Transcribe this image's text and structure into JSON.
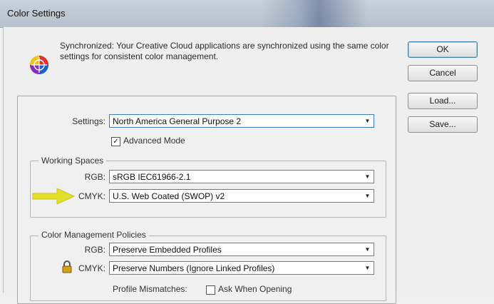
{
  "window": {
    "title": "Color Settings"
  },
  "sync": {
    "message": "Synchronized: Your Creative Cloud applications are synchronized using the same color settings for consistent color management."
  },
  "buttons": {
    "ok": "OK",
    "cancel": "Cancel",
    "load": "Load...",
    "save": "Save..."
  },
  "settings": {
    "label": "Settings:",
    "value": "North America General Purpose 2",
    "advanced_mode_label": "Advanced Mode",
    "advanced_mode_checked": true
  },
  "working_spaces": {
    "legend": "Working Spaces",
    "rgb_label": "RGB:",
    "rgb_value": "sRGB IEC61966-2.1",
    "cmyk_label": "CMYK:",
    "cmyk_value": "U.S. Web Coated (SWOP) v2"
  },
  "policies": {
    "legend": "Color Management Policies",
    "rgb_label": "RGB:",
    "rgb_value": "Preserve Embedded Profiles",
    "cmyk_label": "CMYK:",
    "cmyk_value": "Preserve Numbers (Ignore Linked Profiles)",
    "mismatch_label": "Profile Mismatches:",
    "ask_when_opening_label": "Ask When Opening",
    "ask_when_opening_checked": false
  },
  "colors": {
    "annotation_arrow": "#e2e02a",
    "focus_border": "#3e7bbf"
  },
  "icons": {
    "color_wheel": "color-wheel-icon",
    "lock": "lock-icon",
    "annotation": "yellow-arrow"
  }
}
